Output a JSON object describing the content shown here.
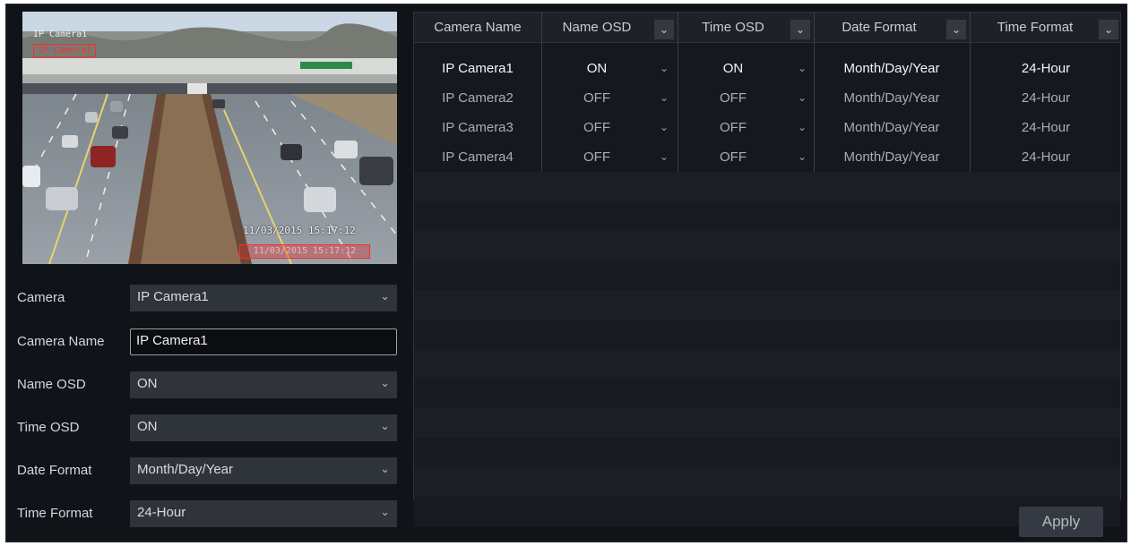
{
  "preview": {
    "osd_name": "IP Camera1",
    "osd_time": "11/03/2015 15:17:12"
  },
  "form": {
    "camera": {
      "label": "Camera",
      "value": "IP Camera1"
    },
    "camera_name": {
      "label": "Camera Name",
      "value": "IP Camera1"
    },
    "name_osd": {
      "label": "Name OSD",
      "value": "ON"
    },
    "time_osd": {
      "label": "Time OSD",
      "value": "ON"
    },
    "date_format": {
      "label": "Date Format",
      "value": "Month/Day/Year"
    },
    "time_format": {
      "label": "Time Format",
      "value": "24-Hour"
    }
  },
  "table": {
    "headers": {
      "camera_name": "Camera Name",
      "name_osd": "Name OSD",
      "time_osd": "Time OSD",
      "date_format": "Date Format",
      "time_format": "Time Format"
    },
    "rows": [
      {
        "camera_name": "IP Camera1",
        "name_osd": "ON",
        "time_osd": "ON",
        "date_format": "Month/Day/Year",
        "time_format": "24-Hour"
      },
      {
        "camera_name": "IP Camera2",
        "name_osd": "OFF",
        "time_osd": "OFF",
        "date_format": "Month/Day/Year",
        "time_format": "24-Hour"
      },
      {
        "camera_name": "IP Camera3",
        "name_osd": "OFF",
        "time_osd": "OFF",
        "date_format": "Month/Day/Year",
        "time_format": "24-Hour"
      },
      {
        "camera_name": "IP Camera4",
        "name_osd": "OFF",
        "time_osd": "OFF",
        "date_format": "Month/Day/Year",
        "time_format": "24-Hour"
      }
    ]
  },
  "apply_label": "Apply",
  "icons": {
    "dropdown": "chevron-down-icon"
  },
  "colors": {
    "background": "#101318",
    "osd_red": "#ff2a2a",
    "field": "#2f343b"
  }
}
